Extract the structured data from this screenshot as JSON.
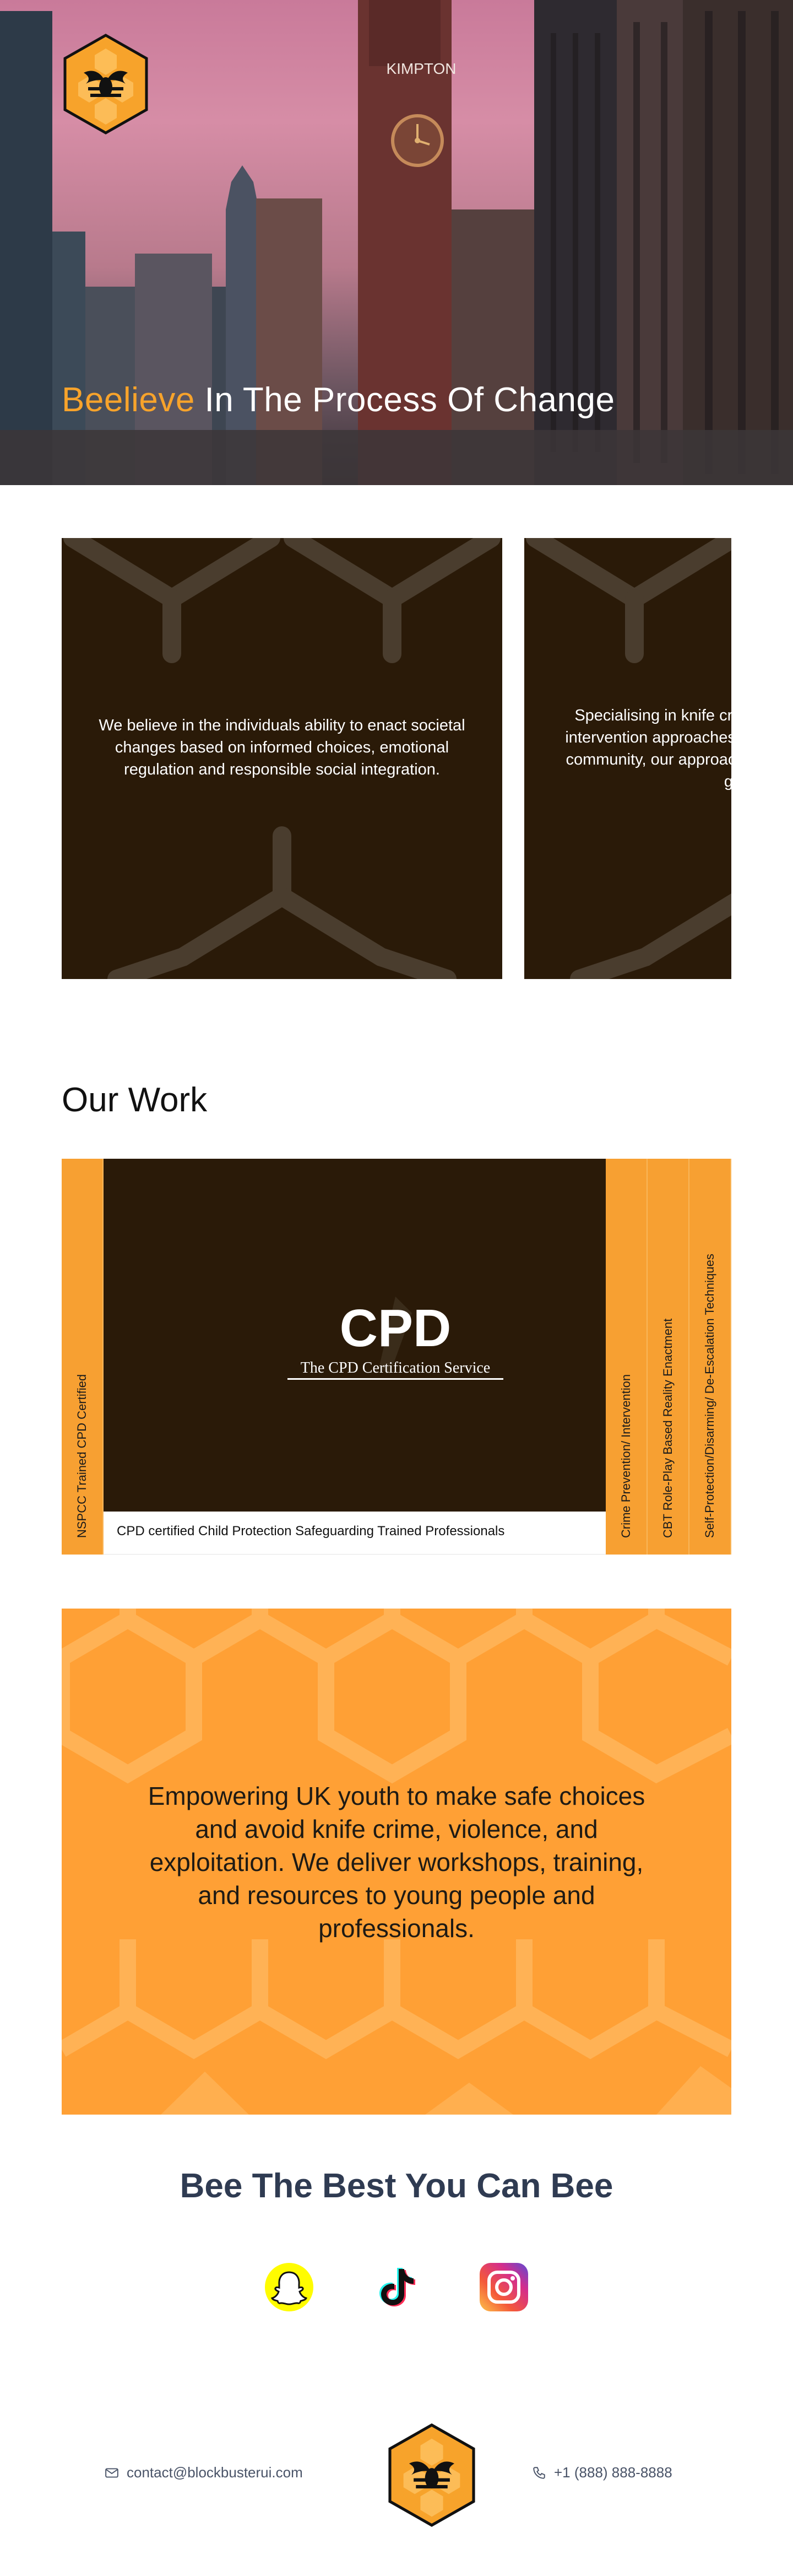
{
  "hero": {
    "building_sign": "KIMPTON",
    "heading_accent": "Beelieve",
    "heading_rest": " In The Process Of Change"
  },
  "intro_cards": [
    {
      "text": "We believe in the individuals ability to enact societal changes based on informed choices, emotional regulation and responsible social integration."
    },
    {
      "text": "Specialising in knife crime awareness and crime intervention approaches that are assimilated within community, our approach strategy helps the young group"
    }
  ],
  "work": {
    "title": "Our Work",
    "tabs": [
      "NSPCC Trained CPD Certified",
      "Crime Prevention/ Intervention",
      "CBT Role-Play Based Reality Enactment",
      "Self-Protection/Disarming/ De-Escalation Techniques"
    ],
    "cpd_logo_text": "CPD",
    "cpd_logo_subtext": "The CPD Certification Service",
    "caption": "CPD certified Child Protection Safeguarding Trained Professionals"
  },
  "mission": {
    "text": "Empowering UK youth to make safe choices and avoid knife crime, violence, and exploitation. We deliver workshops, training, and resources to young people and professionals."
  },
  "slogan": "Bee The Best You Can Bee",
  "social": [
    {
      "name": "snapchat-icon"
    },
    {
      "name": "tiktok-icon"
    },
    {
      "name": "instagram-icon"
    }
  ],
  "footer": {
    "email": "contact@blockbusterui.com",
    "phone": "+1 (888) 888-8888"
  },
  "colors": {
    "accent": "#f7a32b",
    "dark_card": "#2a1a08",
    "mission_bg": "#ffa035",
    "slogan": "#2f3b52"
  }
}
